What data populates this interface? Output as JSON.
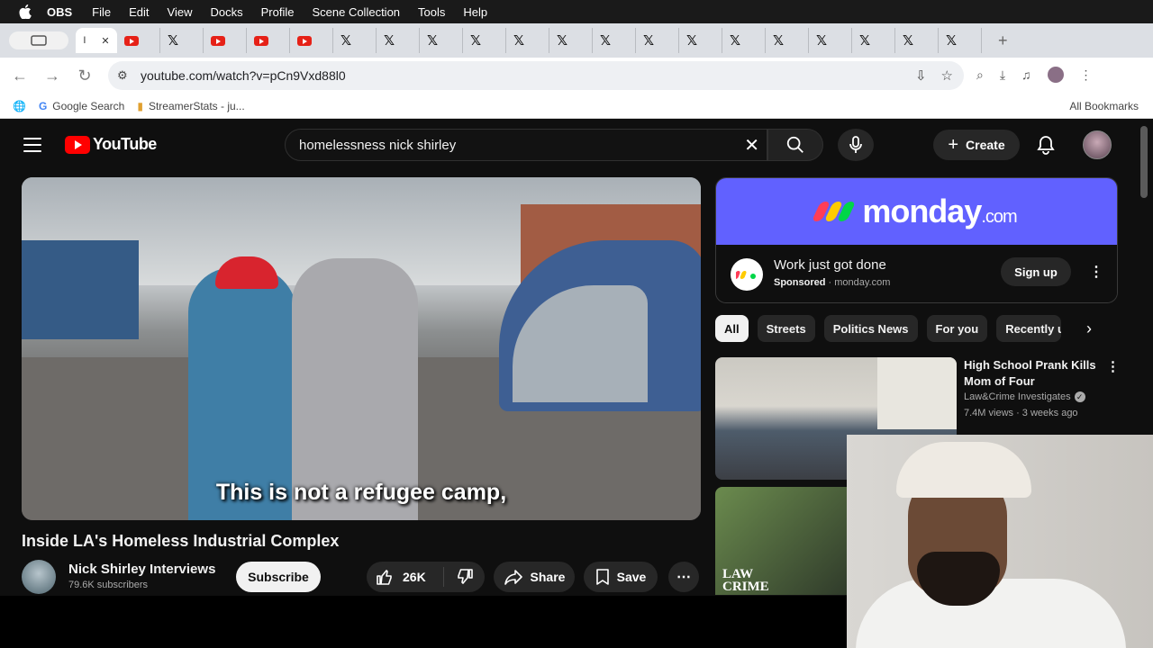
{
  "menubar": {
    "app_name": "OBS",
    "items": [
      "File",
      "Edit",
      "View",
      "Docks",
      "Profile",
      "Scene Collection",
      "Tools",
      "Help"
    ]
  },
  "browser": {
    "url": "youtube.com/watch?v=pCn9Vxd88l0",
    "bookmarks": [
      "Google Search",
      "StreamerStats - ju..."
    ],
    "all_bookmarks": "All Bookmarks",
    "tab_active_label": "I"
  },
  "youtube": {
    "logo_text": "YouTube",
    "search_query": "homelessness nick shirley",
    "create_label": "Create",
    "video": {
      "caption": "This is not a refugee camp,",
      "title": "Inside LA's Homeless Industrial Complex",
      "channel": "Nick Shirley Interviews",
      "subscribers": "79.6K subscribers",
      "subscribe_label": "Subscribe",
      "likes": "26K",
      "share_label": "Share",
      "save_label": "Save"
    },
    "ad": {
      "brand": "monday",
      "brand_suffix": ".com",
      "headline": "Work just got done",
      "sponsored": "Sponsored",
      "domain": "monday.com",
      "cta": "Sign up",
      "colors": {
        "banner": "#6161ff",
        "dot1": "#ff3d57",
        "dot2": "#ffcb00",
        "dot3": "#00d647"
      }
    },
    "chips": [
      "All",
      "Streets",
      "Politics News",
      "For you",
      "Recently uploaded"
    ],
    "recommendation": {
      "title": "High School Prank Kills Mom of Four",
      "channel": "Law&Crime Investigates",
      "meta": "7.4M views · 3 weeks ago",
      "thumb2_text_line1": "LAW",
      "thumb2_text_line2": "CRIME"
    }
  }
}
